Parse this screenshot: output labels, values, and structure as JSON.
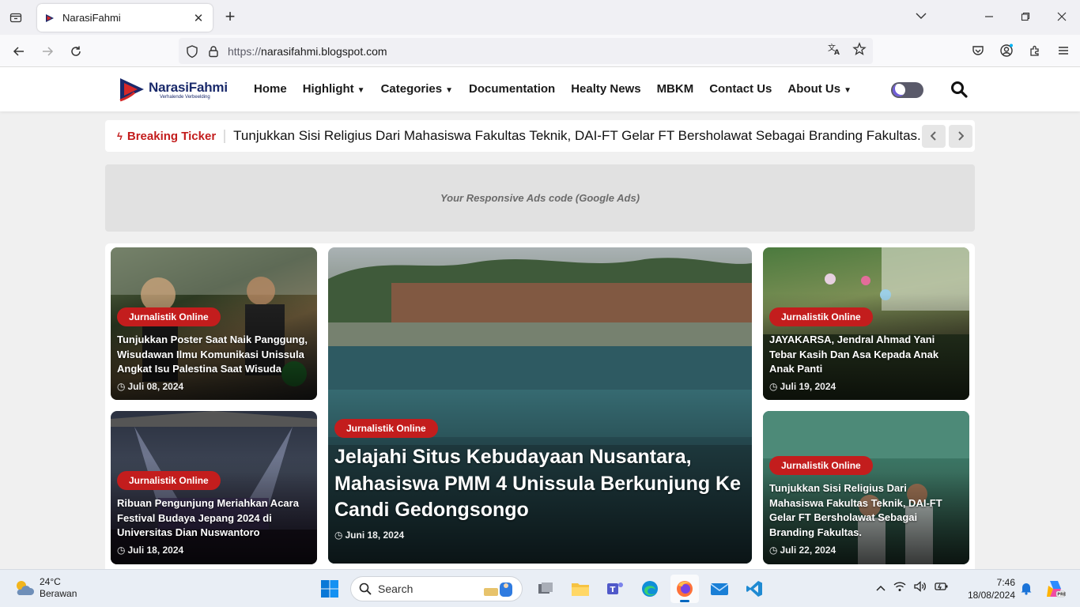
{
  "browser": {
    "tab_title": "NarasiFahmi",
    "new_tab_label": "+",
    "url_protocol": "https://",
    "url_domain": "narasifahmi.blogspot.com"
  },
  "site": {
    "logo_name": "NarasiFahmi",
    "logo_tagline": "Verhalende Verbeelding",
    "menu": [
      {
        "label": "Home",
        "dropdown": false
      },
      {
        "label": "Highlight",
        "dropdown": true
      },
      {
        "label": "Categories",
        "dropdown": true
      },
      {
        "label": "Documentation",
        "dropdown": false
      },
      {
        "label": "Healty News",
        "dropdown": false
      },
      {
        "label": "MBKM",
        "dropdown": false
      },
      {
        "label": "Contact Us",
        "dropdown": false
      },
      {
        "label": "About Us",
        "dropdown": true
      }
    ],
    "ticker": {
      "label": "Breaking Ticker",
      "text": "Tunjukkan Sisi Religius Dari Mahasiswa Fakultas Teknik, DAI-FT Gelar FT Bersholawat Sebagai Branding Fakultas."
    },
    "ads_text": "Your Responsive Ads code (Google Ads)",
    "posts": [
      {
        "tag": "Jurnalistik Online",
        "title": "Tunjukkan Poster Saat Naik Panggung, Wisudawan Ilmu Komunikasi Unissula Angkat Isu Palestina Saat Wisuda",
        "date": "Juli 08, 2024"
      },
      {
        "tag": "Jurnalistik Online",
        "title": "Ribuan Pengunjung Meriahkan Acara Festival Budaya Jepang 2024 di Universitas Dian Nuswantoro",
        "date": "Juli 18, 2024"
      },
      {
        "tag": "Jurnalistik Online",
        "title": "Jelajahi Situs Kebudayaan Nusantara, Mahasiswa PMM 4 Unissula Berkunjung Ke Candi Gedongsongo",
        "date": "Juni 18, 2024"
      },
      {
        "tag": "Jurnalistik Online",
        "title": "JAYAKARSA, Jendral Ahmad Yani Tebar Kasih Dan Asa Kepada Anak Anak Panti",
        "date": "Juli 19, 2024"
      },
      {
        "tag": "Jurnalistik Online",
        "title": "Tunjukkan Sisi Religius Dari Mahasiswa Fakultas Teknik, DAI-FT Gelar FT Bersholawat Sebagai Branding Fakultas.",
        "date": "Juli 22, 2024"
      }
    ],
    "accent_color": "#c31d1d"
  },
  "taskbar": {
    "weather_temp": "24°C",
    "weather_desc": "Berawan",
    "search_placeholder": "Search",
    "time": "7:46",
    "date": "18/08/2024"
  }
}
